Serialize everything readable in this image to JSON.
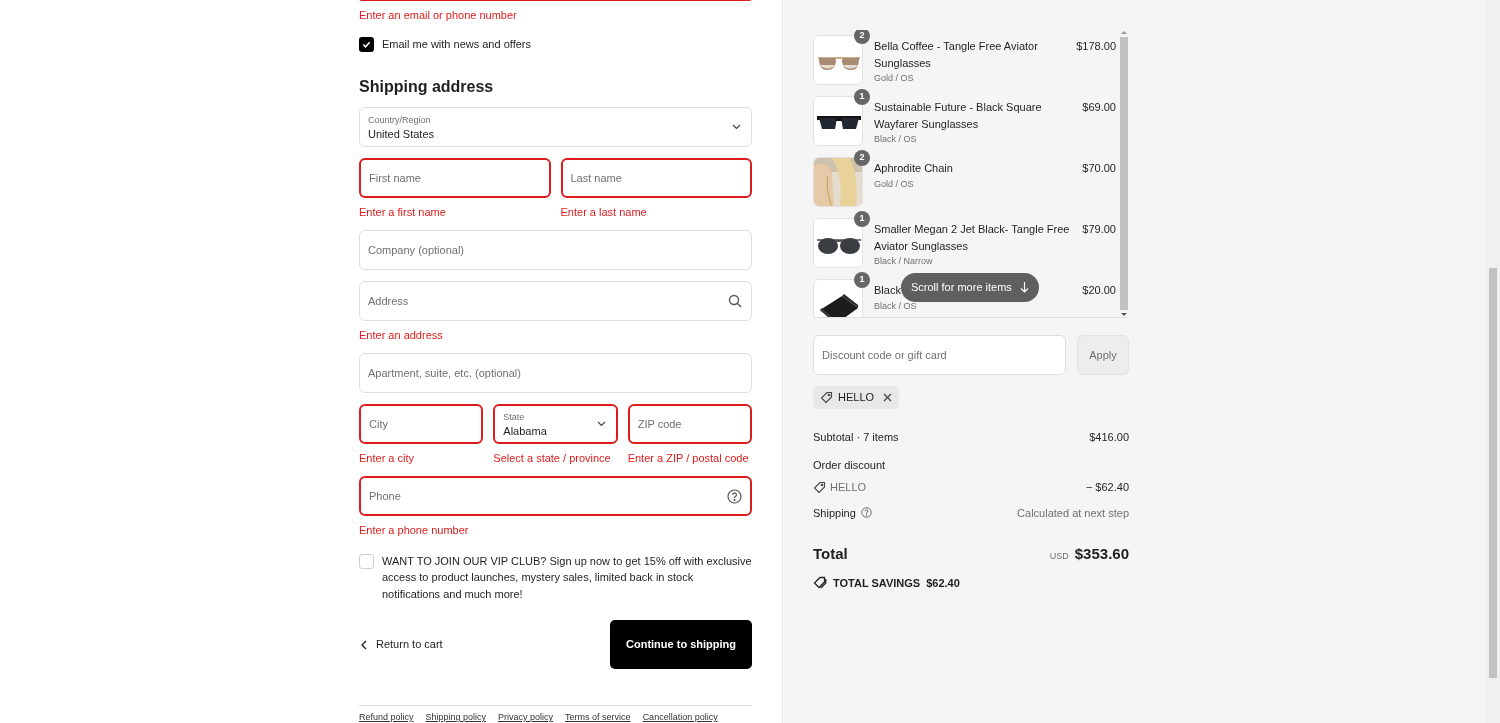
{
  "contact": {
    "email_field": {
      "invalid": true,
      "error": "Enter an email or phone number"
    },
    "newsletter": {
      "label": "Email me with news and offers",
      "checked": true
    }
  },
  "shipping": {
    "heading": "Shipping address",
    "rows": [
      [
        {
          "kind": "select",
          "label": "Country/Region",
          "value": "United States",
          "invalid": false
        }
      ],
      [
        {
          "kind": "text",
          "placeholder": "First name",
          "invalid": true,
          "error": "Enter a first name"
        },
        {
          "kind": "text",
          "placeholder": "Last name",
          "invalid": true,
          "error": "Enter a last name"
        }
      ],
      [
        {
          "kind": "text",
          "placeholder": "Company (optional)",
          "invalid": false
        }
      ],
      [
        {
          "kind": "search",
          "placeholder": "Address",
          "invalid": false,
          "error": "Enter an address"
        }
      ],
      [
        {
          "kind": "text",
          "placeholder": "Apartment, suite, etc. (optional)",
          "invalid": false
        }
      ],
      [
        {
          "kind": "text",
          "placeholder": "City",
          "invalid": true,
          "error": "Enter a city"
        },
        {
          "kind": "select",
          "label": "State",
          "value": "Alabama",
          "invalid": true,
          "error": "Select a state / province"
        },
        {
          "kind": "text",
          "placeholder": "ZIP code",
          "invalid": true,
          "error": "Enter a ZIP / postal code"
        }
      ],
      [
        {
          "kind": "help",
          "placeholder": "Phone",
          "invalid": true,
          "error": "Enter a phone number"
        }
      ]
    ]
  },
  "vip": {
    "label": "WANT TO JOIN OUR VIP CLUB? Sign up now to get 15% off with exclusive access to product launches, mystery sales, limited back in stock notifications and much more!",
    "checked": false
  },
  "actions": {
    "back": "Return to cart",
    "continue": "Continue to shipping"
  },
  "footer_links": [
    "Refund policy",
    "Shipping policy",
    "Privacy policy",
    "Terms of service",
    "Cancellation policy"
  ],
  "summary": {
    "items": [
      {
        "title": "Bella Coffee - Tangle Free Aviator Sunglasses",
        "variant": "Gold / OS",
        "price": "$178.00",
        "quantity": "2",
        "kind": "aviator"
      },
      {
        "title": "Sustainable Future - Black Square Wayfarer Sunglasses",
        "variant": "Black / OS",
        "price": "$69.00",
        "quantity": "1",
        "kind": "wayfarer"
      },
      {
        "title": "Aphrodite Chain",
        "variant": "Gold / OS",
        "price": "$70.00",
        "quantity": "2",
        "kind": "model"
      },
      {
        "title": "Smaller Megan 2 Jet Black- Tangle Free Aviator Sunglasses",
        "variant": "Black / Narrow",
        "price": "$79.00",
        "quantity": "1",
        "kind": "aviator_dark"
      },
      {
        "title": "Black",
        "variant": "Black / OS",
        "price": "$20.00",
        "quantity": "1",
        "kind": "case"
      }
    ],
    "scroll_hint": "Scroll for more items",
    "discount": {
      "placeholder": "Discount code or gift card",
      "button": "Apply"
    },
    "applied_codes": [
      "HELLO"
    ],
    "subtotal": {
      "label": "Subtotal · 7 items",
      "value": "$416.00"
    },
    "order_discount": {
      "label": "Order discount",
      "code": "HELLO",
      "value": "− $62.40"
    },
    "shipping": {
      "label": "Shipping",
      "value": "Calculated at next step"
    },
    "total": {
      "label": "Total",
      "currency": "USD",
      "value": "$353.60"
    },
    "savings": {
      "label": "TOTAL SAVINGS",
      "value": "$62.40"
    }
  }
}
